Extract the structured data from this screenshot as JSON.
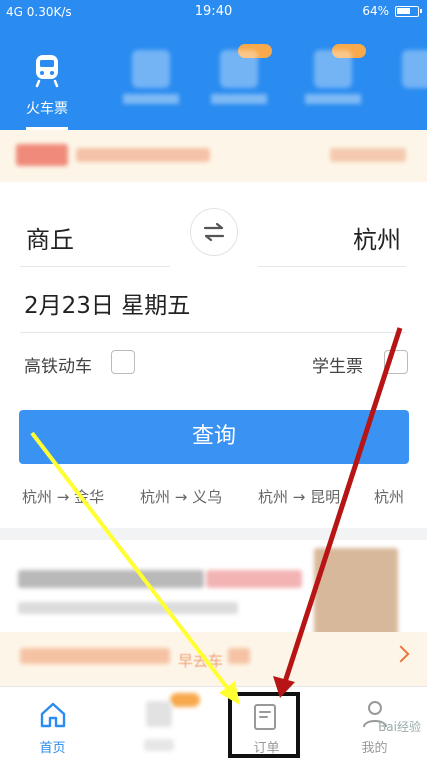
{
  "status_bar": {
    "left": "4G 0.30K/s",
    "time": "19:40",
    "battery": "64%"
  },
  "top_tabs": {
    "active_label": "火车票"
  },
  "search": {
    "from": "商丘",
    "to": "杭州",
    "date": "2月23日  星期五",
    "high_speed_label": "高铁动车",
    "student_label": "学生票",
    "button_label": "查询"
  },
  "history": [
    "杭州 → 金华",
    "杭州 → 义乌",
    "杭州 → 昆明",
    "杭州"
  ],
  "promo": {
    "early_label": "早去车"
  },
  "nav": {
    "home": "首页",
    "orders": "订单",
    "mine": "我的"
  },
  "watermark": "Bai经验",
  "colors": {
    "brand_blue": "#2a8cf0",
    "button_blue": "#3a93f2",
    "annotation_yellow": "#ffff33",
    "annotation_red": "#b71515"
  }
}
